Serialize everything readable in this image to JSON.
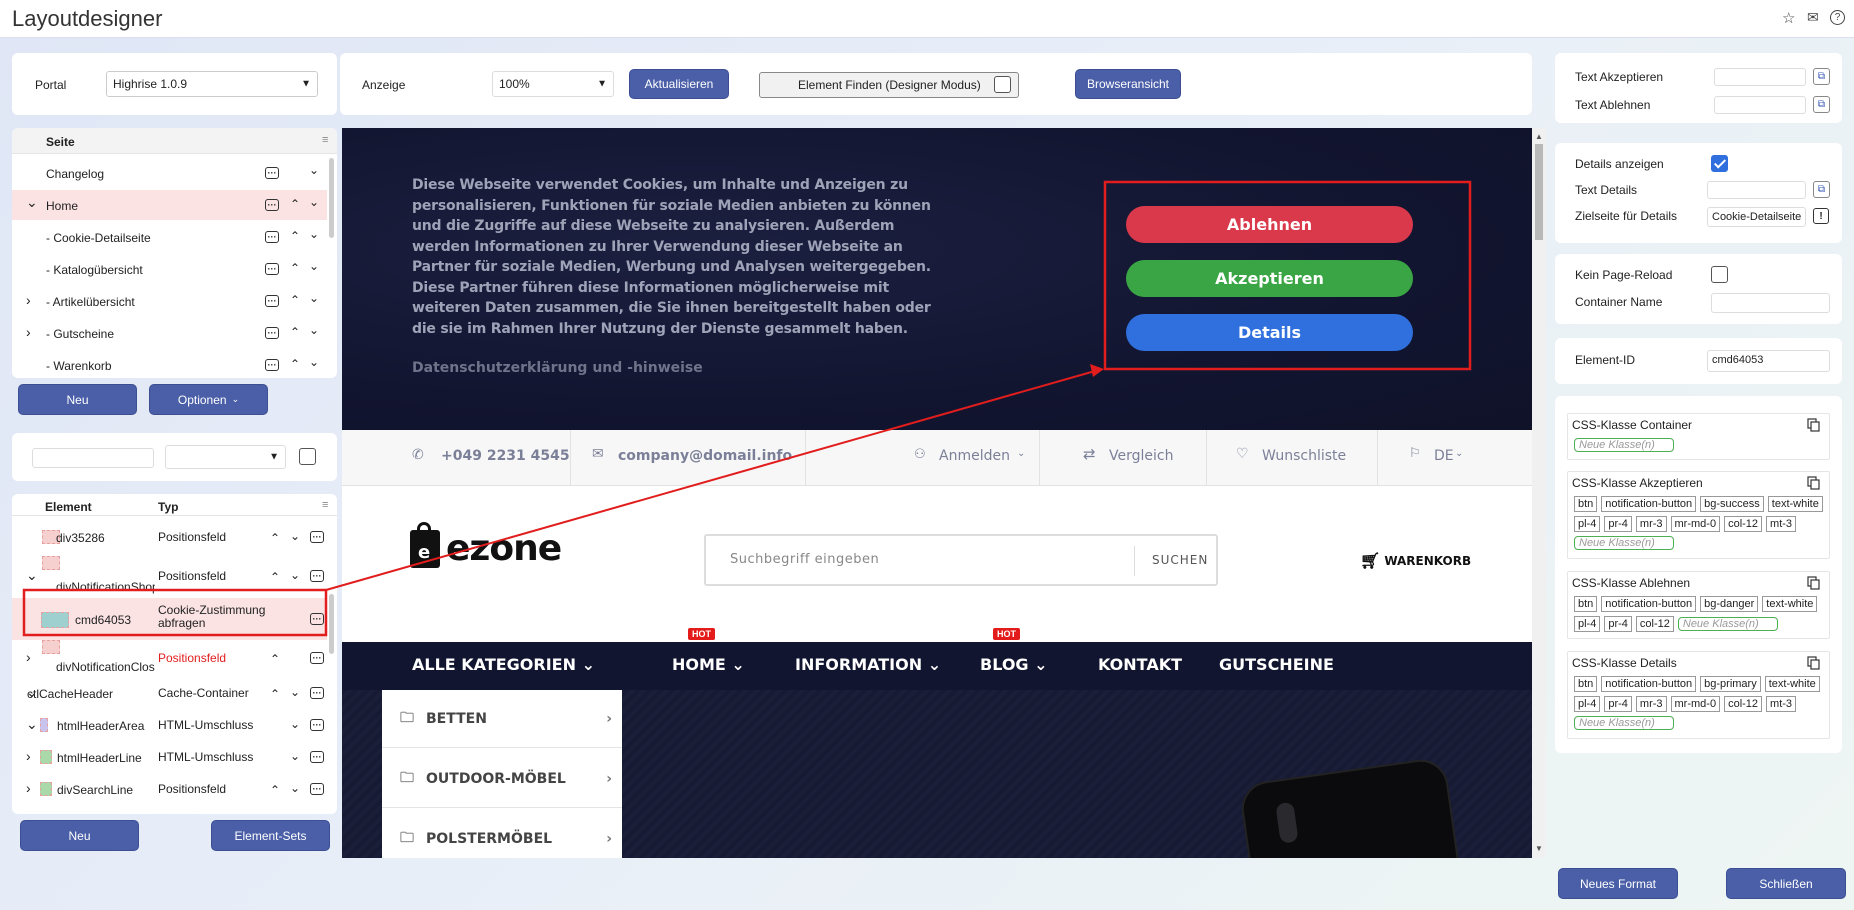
{
  "app": {
    "title": "Layoutdesigner",
    "icons": [
      "star-icon",
      "mail-icon",
      "help-icon"
    ]
  },
  "portal": {
    "label": "Portal",
    "value": "Highrise 1.0.9"
  },
  "toolbar": {
    "anzeige_label": "Anzeige",
    "zoom_value": "100%",
    "refresh_label": "Aktualisieren",
    "find_element_label": "Element Finden (Designer Modus)",
    "browser_view_label": "Browseransicht"
  },
  "page_tree": {
    "header": "Seite",
    "items": [
      {
        "label": "Changelog",
        "expand": ""
      },
      {
        "label": "Home",
        "expand": "v",
        "selected": true
      },
      {
        "label": "- Cookie-Detailseite",
        "expand": ""
      },
      {
        "label": "- Katalogübersicht",
        "expand": ""
      },
      {
        "label": "- Artikelübersicht",
        "expand": ">"
      },
      {
        "label": "- Gutscheine",
        "expand": ">"
      },
      {
        "label": "- Warenkorb",
        "expand": ""
      }
    ],
    "new_label": "Neu",
    "options_label": "Optionen"
  },
  "element_tree": {
    "col_element": "Element",
    "col_type": "Typ",
    "rows": [
      {
        "name": "div35286",
        "type": "Positionsfeld"
      },
      {
        "name": "divNotificationShopM",
        "type": "Positionsfeld"
      },
      {
        "name": "cmd64053",
        "type": "Cookie-Zustimmung abfragen"
      },
      {
        "name": "divNotificationClose",
        "type": "Positionsfeld"
      },
      {
        "name": "ctlCacheHeader",
        "type": "Cache-Container"
      },
      {
        "name": "htmlHeaderArea",
        "type": "HTML-Umschluss"
      },
      {
        "name": "htmlHeaderLine",
        "type": "HTML-Umschluss"
      },
      {
        "name": "divSearchLine",
        "type": "Positionsfeld"
      }
    ],
    "new_label": "Neu",
    "sets_label": "Element-Sets"
  },
  "preview": {
    "cookie_text": "Diese Webseite verwendet Cookies, um Inhalte und Anzeigen zu personalisieren, Funktionen für soziale Medien anbieten zu können und die Zugriffe auf diese Webseite zu analysieren. Außerdem werden Informationen zu Ihrer Verwendung dieser Webseite an Partner für soziale Medien, Werbung und Analysen weitergegeben. Diese Partner führen diese Informationen möglicherweise mit weiteren Daten zusammen, die Sie ihnen bereitgestellt haben oder die sie im Rahmen Ihrer Nutzung der Dienste gesammelt haben.",
    "privacy_link": "Datenschutzerklärung und -hinweise",
    "btn_reject": "Ablehnen",
    "btn_accept": "Akzeptieren",
    "btn_details": "Details",
    "phone": "+049 2231 4545",
    "email": "company@domail.info",
    "login": "Anmelden",
    "compare": "Vergleich",
    "wishlist": "Wunschliste",
    "lang": "DE",
    "logo": "ezone",
    "search_placeholder": "Suchbegriff eingeben",
    "search_btn": "SUCHEN",
    "cart": "WARENKORB",
    "nav": [
      "ALLE KATEGORIEN",
      "HOME",
      "INFORMATION",
      "BLOG",
      "KONTAKT",
      "GUTSCHEINE"
    ],
    "hot": "HOT",
    "categories": [
      "BETTEN",
      "OUTDOOR-MÖBEL",
      "POLSTERMÖBEL"
    ]
  },
  "props": {
    "text_accept": "Text Akzeptieren",
    "text_reject": "Text Ablehnen",
    "details_show": "Details anzeigen",
    "details_checked": true,
    "text_details": "Text Details",
    "target_details": "Zielseite für Details",
    "target_details_value": "Cookie-Detailseite",
    "no_reload": "Kein Page-Reload",
    "container_name": "Container Name",
    "element_id_label": "Element-ID",
    "element_id_value": "cmd64053",
    "css_container": "CSS-Klasse Container",
    "css_accept": "CSS-Klasse Akzeptieren",
    "css_reject": "CSS-Klasse Ablehnen",
    "css_details": "CSS-Klasse Details",
    "new_class_placeholder": "Neue Klasse(n)",
    "accept_classes": [
      "btn",
      "notification-button",
      "bg-success",
      "text-white",
      "pl-4",
      "pr-4",
      "mr-3",
      "mr-md-0",
      "col-12",
      "mt-3"
    ],
    "reject_classes": [
      "btn",
      "notification-button",
      "bg-danger",
      "text-white",
      "pl-4",
      "pr-4",
      "col-12"
    ],
    "details_classes": [
      "btn",
      "notification-button",
      "bg-primary",
      "text-white",
      "pl-4",
      "pr-4",
      "mr-3",
      "mr-md-0",
      "col-12",
      "mt-3"
    ]
  },
  "footer": {
    "new_format": "Neues Format",
    "close": "Schließen"
  },
  "colors": {
    "accent": "#4a5fa8",
    "reject": "#d9394a",
    "accept": "#3aa544",
    "details": "#2f6fde",
    "annotation": "#e11d1d"
  }
}
